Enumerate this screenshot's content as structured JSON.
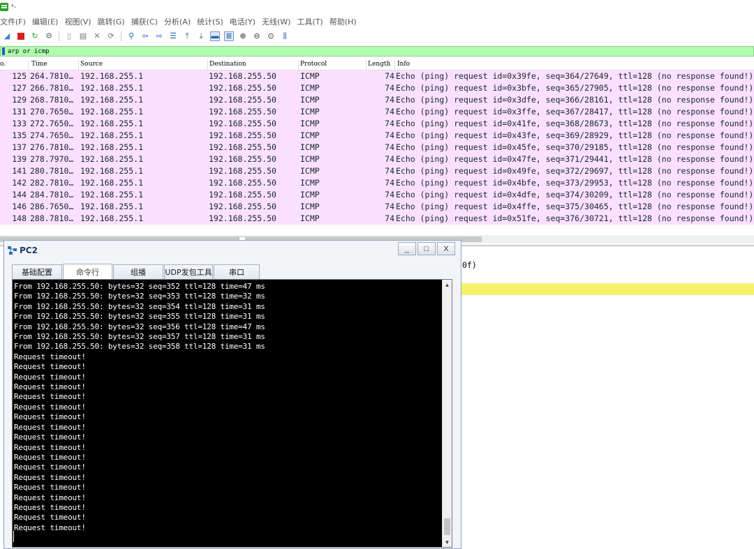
{
  "window": {
    "title": "*-"
  },
  "menu": [
    "文件(F)",
    "编辑(E)",
    "视图(V)",
    "跳转(G)",
    "捕获(C)",
    "分析(A)",
    "统计(S)",
    "电话(Y)",
    "无线(W)",
    "工具(T)",
    "帮助(H)"
  ],
  "toolbar": {
    "icons": [
      "shark-fin-start-icon",
      "stop-capture-icon",
      "restart-capture-icon",
      "capture-options-icon",
      "open-file-icon",
      "save-file-icon",
      "close-file-icon",
      "reload-file-icon",
      "find-packet-icon",
      "go-back-icon",
      "go-forward-icon",
      "go-to-packet-icon",
      "go-first-icon",
      "go-last-icon",
      "auto-scroll-icon",
      "colorize-icon",
      "zoom-in-icon",
      "zoom-out-icon",
      "zoom-normal-icon",
      "resize-columns-icon"
    ],
    "accent": "#2a5db0"
  },
  "filter": {
    "value": "arp or icmp",
    "background": "#afffaf"
  },
  "packet_list": {
    "columns": [
      "o.",
      "Time",
      "Source",
      "Destination",
      "Protocol",
      "Length",
      "Info"
    ],
    "row_color": "#fce0ff",
    "rows": [
      {
        "no": "125",
        "time": "264.7810…",
        "source": "192.168.255.1",
        "destination": "192.168.255.50",
        "protocol": "ICMP",
        "length": "74",
        "info": "Echo (ping) request  id=0x39fe, seq=364/27649, ttl=128 (no response found!)"
      },
      {
        "no": "127",
        "time": "266.7810…",
        "source": "192.168.255.1",
        "destination": "192.168.255.50",
        "protocol": "ICMP",
        "length": "74",
        "info": "Echo (ping) request  id=0x3bfe, seq=365/27905, ttl=128 (no response found!)"
      },
      {
        "no": "129",
        "time": "268.7810…",
        "source": "192.168.255.1",
        "destination": "192.168.255.50",
        "protocol": "ICMP",
        "length": "74",
        "info": "Echo (ping) request  id=0x3dfe, seq=366/28161, ttl=128 (no response found!)"
      },
      {
        "no": "131",
        "time": "270.7650…",
        "source": "192.168.255.1",
        "destination": "192.168.255.50",
        "protocol": "ICMP",
        "length": "74",
        "info": "Echo (ping) request  id=0x3ffe, seq=367/28417, ttl=128 (no response found!)"
      },
      {
        "no": "133",
        "time": "272.7650…",
        "source": "192.168.255.1",
        "destination": "192.168.255.50",
        "protocol": "ICMP",
        "length": "74",
        "info": "Echo (ping) request  id=0x41fe, seq=368/28673, ttl=128 (no response found!)"
      },
      {
        "no": "135",
        "time": "274.7650…",
        "source": "192.168.255.1",
        "destination": "192.168.255.50",
        "protocol": "ICMP",
        "length": "74",
        "info": "Echo (ping) request  id=0x43fe, seq=369/28929, ttl=128 (no response found!)"
      },
      {
        "no": "137",
        "time": "276.7810…",
        "source": "192.168.255.1",
        "destination": "192.168.255.50",
        "protocol": "ICMP",
        "length": "74",
        "info": "Echo (ping) request  id=0x45fe, seq=370/29185, ttl=128 (no response found!)"
      },
      {
        "no": "139",
        "time": "278.7970…",
        "source": "192.168.255.1",
        "destination": "192.168.255.50",
        "protocol": "ICMP",
        "length": "74",
        "info": "Echo (ping) request  id=0x47fe, seq=371/29441, ttl=128 (no response found!)"
      },
      {
        "no": "141",
        "time": "280.7810…",
        "source": "192.168.255.1",
        "destination": "192.168.255.50",
        "protocol": "ICMP",
        "length": "74",
        "info": "Echo (ping) request  id=0x49fe, seq=372/29697, ttl=128 (no response found!)"
      },
      {
        "no": "142",
        "time": "282.7810…",
        "source": "192.168.255.1",
        "destination": "192.168.255.50",
        "protocol": "ICMP",
        "length": "74",
        "info": "Echo (ping) request  id=0x4bfe, seq=373/29953, ttl=128 (no response found!)"
      },
      {
        "no": "144",
        "time": "284.7810…",
        "source": "192.168.255.1",
        "destination": "192.168.255.50",
        "protocol": "ICMP",
        "length": "74",
        "info": "Echo (ping) request  id=0x4dfe, seq=374/30209, ttl=128 (no response found!)"
      },
      {
        "no": "146",
        "time": "286.7650…",
        "source": "192.168.255.1",
        "destination": "192.168.255.50",
        "protocol": "ICMP",
        "length": "74",
        "info": "Echo (ping) request  id=0x4ffe, seq=375/30465, ttl=128 (no response found!)"
      },
      {
        "no": "148",
        "time": "288.7810…",
        "source": "192.168.255.1",
        "destination": "192.168.255.50",
        "protocol": "ICMP",
        "length": "74",
        "info": "Echo (ping) request  id=0x51fe, seq=376/30721, ttl=128 (no response found!)"
      }
    ]
  },
  "detail": {
    "text": "0f)",
    "highlight_color": "#f7f26e"
  },
  "pc_window": {
    "title": "PC2",
    "controls": [
      "_",
      "□",
      "X"
    ],
    "tabs": [
      "基础配置",
      "命令行",
      "组播",
      "UDP发包工具",
      "串口"
    ],
    "active_tab": "命令行",
    "console_lines": [
      "From 192.168.255.50: bytes=32 seq=352 ttl=128 time=47 ms",
      "From 192.168.255.50: bytes=32 seq=353 ttl=128 time=32 ms",
      "From 192.168.255.50: bytes=32 seq=354 ttl=128 time=31 ms",
      "From 192.168.255.50: bytes=32 seq=355 ttl=128 time=31 ms",
      "From 192.168.255.50: bytes=32 seq=356 ttl=128 time=47 ms",
      "From 192.168.255.50: bytes=32 seq=357 ttl=128 time=31 ms",
      "From 192.168.255.50: bytes=32 seq=358 ttl=128 time=31 ms",
      "Request timeout!",
      "Request timeout!",
      "Request timeout!",
      "Request timeout!",
      "Request timeout!",
      "Request timeout!",
      "Request timeout!",
      "Request timeout!",
      "Request timeout!",
      "Request timeout!",
      "Request timeout!",
      "Request timeout!",
      "Request timeout!",
      "Request timeout!",
      "Request timeout!",
      "Request timeout!",
      "Request timeout!",
      "Request timeout!"
    ],
    "console_bg": "#000000",
    "console_fg": "#ffffff"
  }
}
